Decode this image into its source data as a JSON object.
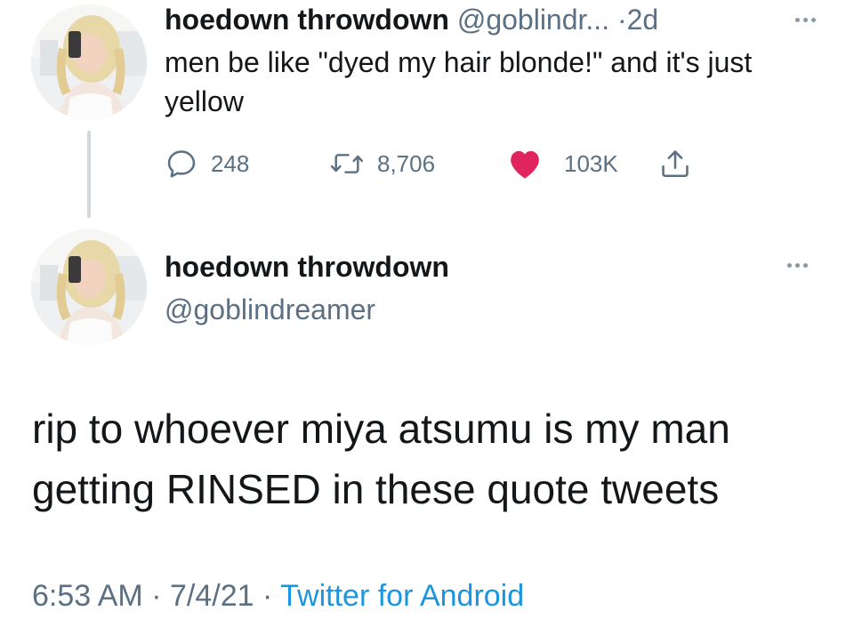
{
  "tweet1": {
    "display_name": "hoedown throwdown",
    "handle": "@goblindr...",
    "separator": "·",
    "age": "2d",
    "body": "men be like \"dyed my hair blonde!\" and it's just yellow",
    "actions": {
      "reply_count": "248",
      "retweet_count": "8,706",
      "like_count": "103K"
    },
    "avatar_icon": "profile-photo",
    "more_icon": "more-dots-icon"
  },
  "tweet2": {
    "display_name": "hoedown throwdown",
    "handle": "@goblindreamer",
    "body": "rip to whoever miya atsumu is my man getting RINSED in these quote tweets",
    "time": "6:53 AM",
    "sep1": "·",
    "date": "7/4/21",
    "sep2": "·",
    "source": "Twitter for Android",
    "avatar_icon": "profile-photo",
    "more_icon": "more-dots-icon"
  },
  "colors": {
    "text_primary": "#14171a",
    "text_secondary": "#5b7083",
    "like_red": "#e0245e",
    "link_blue": "#1b95e0",
    "thread_line": "#cfd9de"
  }
}
